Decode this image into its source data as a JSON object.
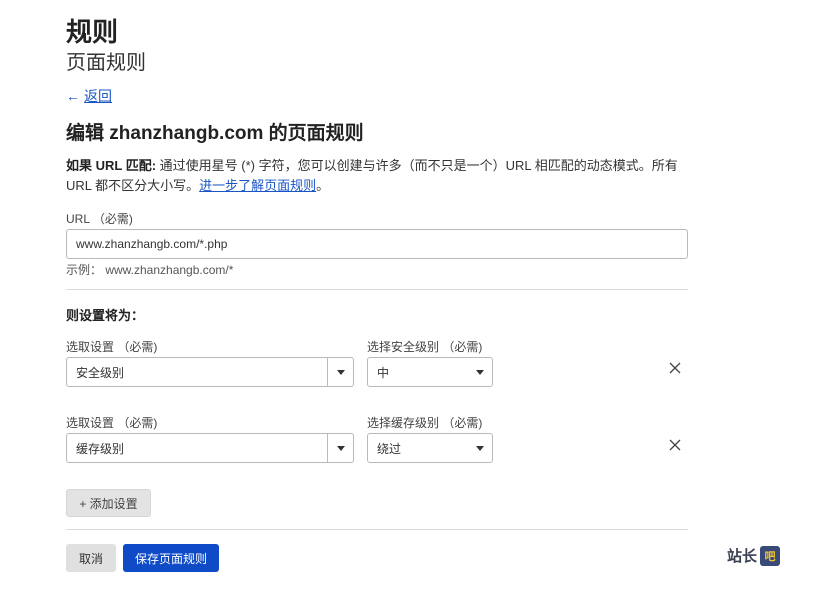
{
  "header": {
    "title": "规则",
    "subtitle": "页面规则"
  },
  "back": {
    "arrow": "←",
    "label": "返回"
  },
  "edit_heading": "编辑 zhanzhangb.com 的页面规则",
  "description": {
    "bold": "如果 URL 匹配:",
    "text": " 通过使用星号 (*) 字符，您可以创建与许多（而不只是一个）URL 相匹配的动态模式。所有 URL 都不区分大小写。",
    "link": "进一步了解页面规则",
    "end": "。"
  },
  "url_field": {
    "label": "URL （必需)",
    "value": "www.zhanzhangb.com/*.php",
    "example": "示例： www.zhanzhangb.com/*"
  },
  "settings_heading": "则设置将为：",
  "rows": [
    {
      "setting_label": "选取设置 （必需)",
      "setting_value": "安全级别",
      "option_label": "选择安全级别 （必需)",
      "option_value": "中"
    },
    {
      "setting_label": "选取设置 （必需)",
      "setting_value": "缓存级别",
      "option_label": "选择缓存级别 （必需)",
      "option_value": "绕过"
    }
  ],
  "add_button": "+ 添加设置",
  "cancel_button": "取消",
  "save_button": "保存页面规则",
  "watermark": {
    "text": "站长",
    "badge": "吧"
  },
  "colors": {
    "accent": "#0f4ac7",
    "link": "#1a55c7"
  }
}
